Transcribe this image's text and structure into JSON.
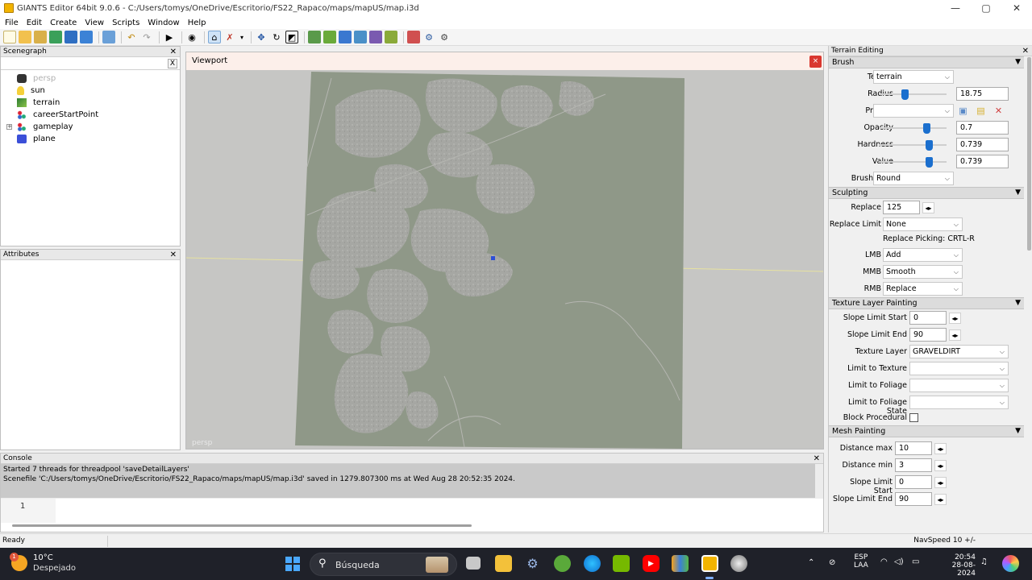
{
  "window": {
    "title": "GIANTS Editor 64bit 9.0.6 - C:/Users/tomys/OneDrive/Escritorio/FS22_Rapaco/maps/mapUS/map.i3d",
    "minimize": "—",
    "maximize": "▢",
    "close": "✕"
  },
  "menu": [
    "File",
    "Edit",
    "Create",
    "View",
    "Scripts",
    "Window",
    "Help"
  ],
  "scenegraph": {
    "title": "Scenegraph",
    "close": "✕",
    "search_clear": "X",
    "items": [
      {
        "label": "persp",
        "icon": "camera-icon"
      },
      {
        "label": "sun",
        "icon": "light-icon"
      },
      {
        "label": "terrain",
        "icon": "terrain-icon"
      },
      {
        "label": "careerStartPoint",
        "icon": "transform-group-icon"
      },
      {
        "label": "gameplay",
        "icon": "transform-group-icon"
      },
      {
        "label": "plane",
        "icon": "shape-icon"
      }
    ]
  },
  "attributes": {
    "title": "Attributes",
    "close": "✕"
  },
  "viewport": {
    "title": "Viewport",
    "close": "×",
    "camera": "persp"
  },
  "console": {
    "title": "Console",
    "close": "✕",
    "lines": [
      "Started 7 threads for threadpool 'saveDetailLayers'",
      "Scenefile 'C:/Users/tomys/OneDrive/Escritorio/FS22_Rapaco/maps/mapUS/map.i3d' saved in 1279.807300 ms at Wed Aug 28 20:52:35 2024."
    ],
    "line_number": "1"
  },
  "status": {
    "left": "Ready",
    "right": "NavSpeed 10 +/-"
  },
  "terrain_editing": {
    "title": "Terrain Editing",
    "close": "✕",
    "brush": {
      "section": "Brush",
      "terrain_label": "Terrain",
      "terrain_value": "terrain",
      "radius_label": "Radius",
      "radius_value": "18.75",
      "radius_level": 0.38,
      "presets_label": "Presets",
      "presets_value": "",
      "opacity_label": "Opacity",
      "opacity_value": "0.7",
      "opacity_level": 0.7,
      "hardness_label": "Hardness",
      "hardness_value": "0.739",
      "hardness_level": 0.739,
      "value_label": "Value",
      "value_value": "0.739",
      "value_level": 0.739,
      "brush_type_label": "Brush Type",
      "brush_type_value": "Round"
    },
    "sculpting": {
      "section": "Sculpting",
      "replace_label": "Replace",
      "replace_value": "125",
      "replace_limit_label": "Replace Limit",
      "replace_limit_value": "None",
      "replace_picking": "Replace Picking: CRTL-R",
      "lmb_label": "LMB",
      "lmb_value": "Add",
      "mmb_label": "MMB",
      "mmb_value": "Smooth",
      "rmb_label": "RMB",
      "rmb_value": "Replace"
    },
    "texture": {
      "section": "Texture Layer Painting",
      "slope_start_label": "Slope Limit Start",
      "slope_start_value": "0",
      "slope_end_label": "Slope Limit End",
      "slope_end_value": "90",
      "layer_label": "Texture Layer",
      "layer_value": "GRAVELDIRT",
      "limit_texture_label": "Limit to Texture",
      "limit_texture_value": "",
      "limit_foliage_label": "Limit to Foliage",
      "limit_foliage_value": "",
      "limit_foliage_state_label": "Limit to Foliage State",
      "limit_foliage_state_value": "",
      "block_procedural_label": "Block Procedural"
    },
    "mesh": {
      "section": "Mesh Painting",
      "dist_max_label": "Distance max",
      "dist_max_value": "10",
      "dist_min_label": "Distance min",
      "dist_min_value": "3",
      "slope_start_label": "Slope Limit Start",
      "slope_start_value": "0",
      "slope_end_label": "Slope Limit End",
      "slope_end_value": "90"
    },
    "spin_glyph": "◂▸",
    "collapse_glyph": "▼",
    "dropdown_glyph": "⌵"
  },
  "taskbar": {
    "temperature": "10°C",
    "condition": "Despejado",
    "weather_badge": "1",
    "search": "Búsqueda",
    "language": "ESP",
    "language_sub": "LAA",
    "time": "20:54",
    "date": "28-08-2024"
  },
  "colors": {
    "accent": "#1b6fce",
    "terrain_light": "#a9aaa6",
    "terrain_dark": "#8e9787",
    "viewport_close": "#d9372f"
  }
}
